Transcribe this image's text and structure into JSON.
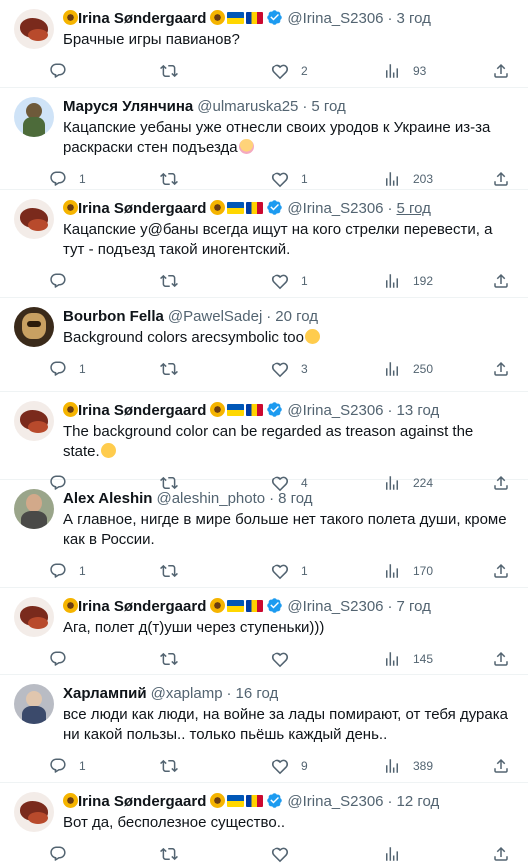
{
  "tweets": [
    {
      "name": "Irina Søndergaard",
      "handle": "@Irina_S2306",
      "time": "3 год",
      "text": "Брачные игры павианов?",
      "reply": "",
      "retweet": "",
      "like": "2",
      "views": "93",
      "avatar": "irina",
      "emoji": "",
      "flags": true,
      "underline": false
    },
    {
      "name": "Маруся Улянчина",
      "handle": "@ulmaruska25",
      "time": "5 год",
      "text": "Кацапские yeбаны уже отнесли своих уродов к Украине из-за раскраски стен подъезда",
      "reply": "1",
      "retweet": "",
      "like": "1",
      "views": "203",
      "avatar": "marusya",
      "emoji": "facepalm",
      "flags": false,
      "underline": false
    },
    {
      "name": "Irina Søndergaard",
      "handle": "@Irina_S2306",
      "time": "5 год",
      "text": "Кацапские у@баны всегда ищут на кого стрелки перевести, а тут - подъезд такой иногентский.",
      "reply": "",
      "retweet": "",
      "like": "1",
      "views": "192",
      "avatar": "irina",
      "emoji": "",
      "flags": true,
      "underline": true
    },
    {
      "name": "Bourbon Fella",
      "handle": "@PawelSadej",
      "time": "20 год",
      "text": "Background colors arecsymbolic too",
      "reply": "1",
      "retweet": "",
      "like": "3",
      "views": "250",
      "avatar": "bourbon",
      "emoji": "hearteyes",
      "flags": false,
      "underline": false
    },
    {
      "name": "Irina Søndergaard",
      "handle": "@Irina_S2306",
      "time": "13 год",
      "text": "The background color can be regarded as treason against the state.",
      "reply": "",
      "retweet": "",
      "like": "4",
      "views": "224",
      "avatar": "irina",
      "emoji": "laugh",
      "flags": true,
      "underline": false
    },
    {
      "name": "Alex Aleshin",
      "handle": "@aleshin_photo",
      "time": "8 год",
      "text": "А главное, нигде в мире больше нет такого полета души, кроме как в России.",
      "reply": "1",
      "retweet": "",
      "like": "1",
      "views": "170",
      "avatar": "alex",
      "emoji": "",
      "flags": false,
      "underline": false
    },
    {
      "name": "Irina Søndergaard",
      "handle": "@Irina_S2306",
      "time": "7 год",
      "text": "Ага, полет д(т)уши через ступеньки)))",
      "reply": "",
      "retweet": "",
      "like": "",
      "views": "145",
      "avatar": "irina",
      "emoji": "",
      "flags": true,
      "underline": false
    },
    {
      "name": "Харлампий",
      "handle": "@xaplamp",
      "time": "16 год",
      "text": "все люди как люди, на войне за лады помирают, от тебя дурака ни какой пользы.. только пьёшь каждый день..",
      "reply": "1",
      "retweet": "",
      "like": "9",
      "views": "389",
      "avatar": "harl",
      "emoji": "",
      "flags": false,
      "underline": false
    },
    {
      "name": "Irina Søndergaard",
      "handle": "@Irina_S2306",
      "time": "12 год",
      "text": "Вот да, бесполезное существо..",
      "reply": "",
      "retweet": "",
      "like": "",
      "views": "",
      "avatar": "irina",
      "emoji": "",
      "flags": true,
      "underline": false
    }
  ],
  "icons": {
    "reply": "reply-icon",
    "retweet": "retweet-icon",
    "like": "heart-icon",
    "views": "views-icon",
    "share": "share-icon",
    "verified": "verified-badge-icon"
  },
  "colors": {
    "verified": "#1d9bf0",
    "muted": "#536471"
  }
}
